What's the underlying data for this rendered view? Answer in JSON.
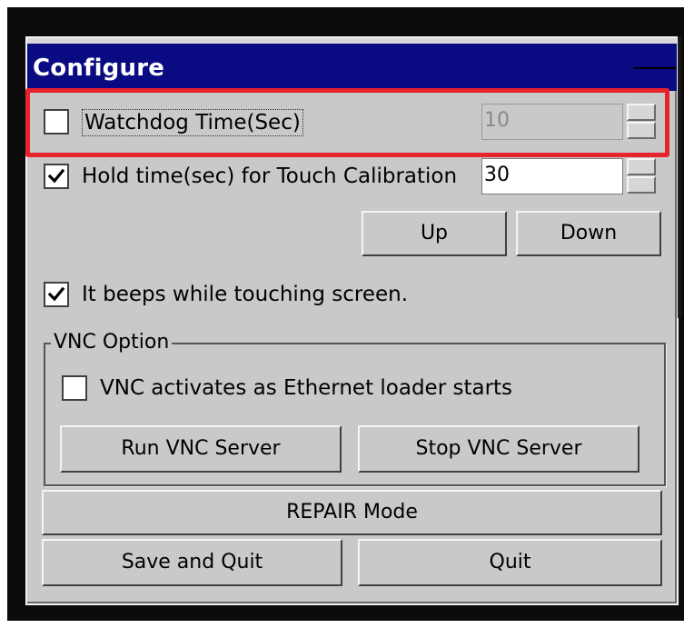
{
  "window": {
    "title": "Configure"
  },
  "watchdog": {
    "label": "Watchdog Time(Sec)",
    "checked": false,
    "value": "10",
    "enabled": false
  },
  "hold_time": {
    "label": "Hold time(sec) for Touch Calibration",
    "checked": true,
    "value": "30"
  },
  "buttons": {
    "up": "Up",
    "down": "Down",
    "run_vnc": "Run VNC Server",
    "stop_vnc": "Stop VNC Server",
    "repair": "REPAIR Mode",
    "save_quit": "Save and Quit",
    "quit": "Quit"
  },
  "beep": {
    "label": "It beeps while touching screen.",
    "checked": true
  },
  "vnc": {
    "group_label": "VNC Option",
    "activate_label": "VNC activates as Ethernet loader starts",
    "activate_checked": false
  },
  "colors": {
    "title_bar": "#0a0a82",
    "dialog_bg": "#c9c9c9",
    "highlight": "#e8232b"
  }
}
